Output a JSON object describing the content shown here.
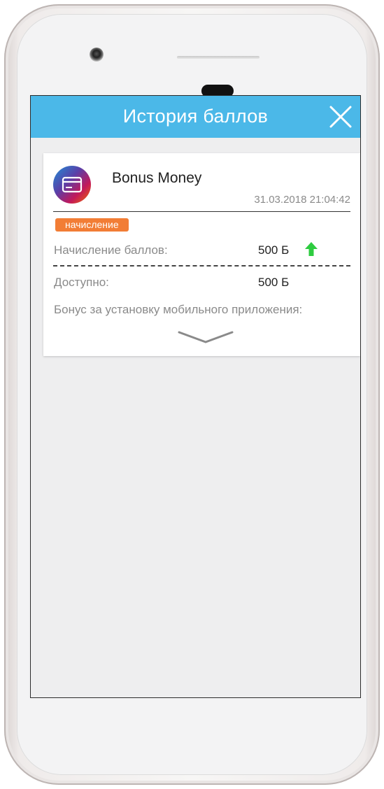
{
  "header": {
    "title": "История баллов"
  },
  "transaction": {
    "title": "Bonus Money",
    "datetime": "31.03.2018 21:04:42",
    "badge": "начисление",
    "accrual_label": "Начисление баллов:",
    "accrual_value": "500 Б",
    "available_label": "Доступно:",
    "available_value": "500 Б",
    "description": "Бонус за установку мобильного приложения:"
  },
  "colors": {
    "header_bg": "#4bb8e8",
    "badge_bg": "#f27d35",
    "arrow_up": "#2ecc40"
  },
  "icons": {
    "close": "close-icon",
    "card": "credit-card-icon",
    "arrow": "arrow-up-icon",
    "expand": "chevron-down-icon"
  }
}
